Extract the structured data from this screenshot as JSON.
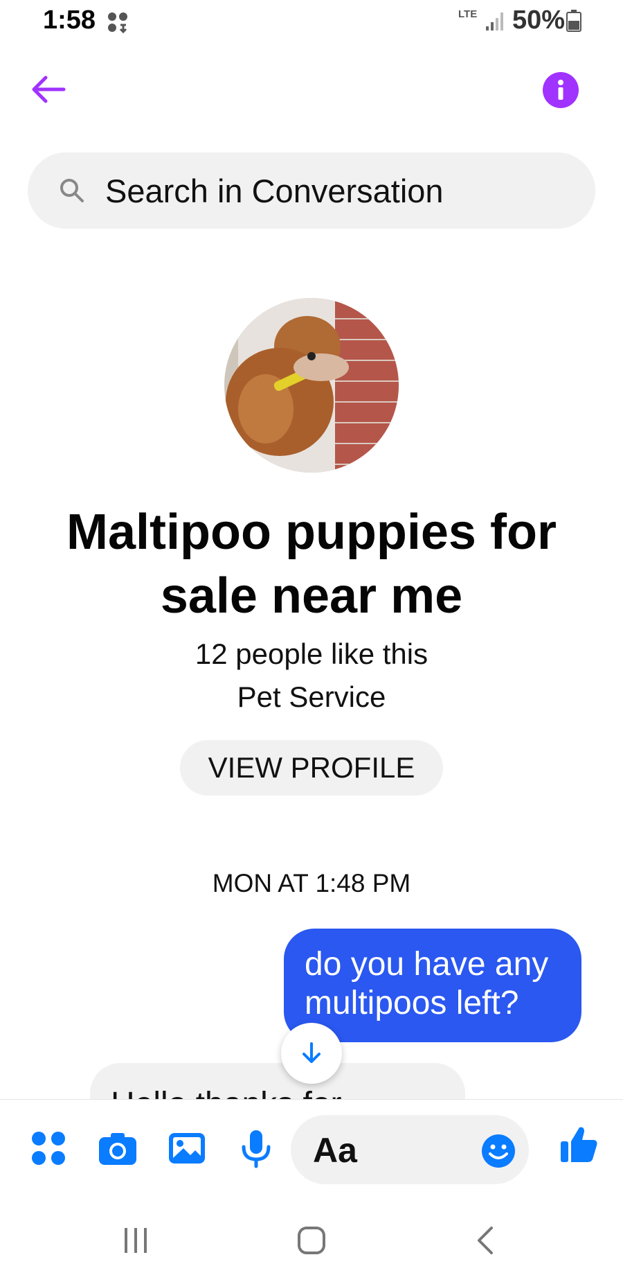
{
  "status_bar": {
    "time": "1:58",
    "network": "LTE",
    "battery": "50%"
  },
  "header": {},
  "search": {
    "label": "Search in Conversation"
  },
  "profile": {
    "name": "Maltipoo puppies for sale near me",
    "likes": "12 people like this",
    "category": "Pet Service",
    "view_profile_label": "VIEW PROFILE"
  },
  "chat": {
    "timestamp": "MON AT 1:48 PM",
    "messages": [
      {
        "direction": "outgoing",
        "text": "do you have any multipoos left?"
      },
      {
        "direction": "incoming",
        "text": "Hello thanks for"
      }
    ]
  },
  "composer": {
    "placeholder": "Aa"
  },
  "colors": {
    "accent": "#a033ff",
    "messenger_blue": "#0a7cff",
    "outgoing_bubble": "#2a58f0"
  }
}
